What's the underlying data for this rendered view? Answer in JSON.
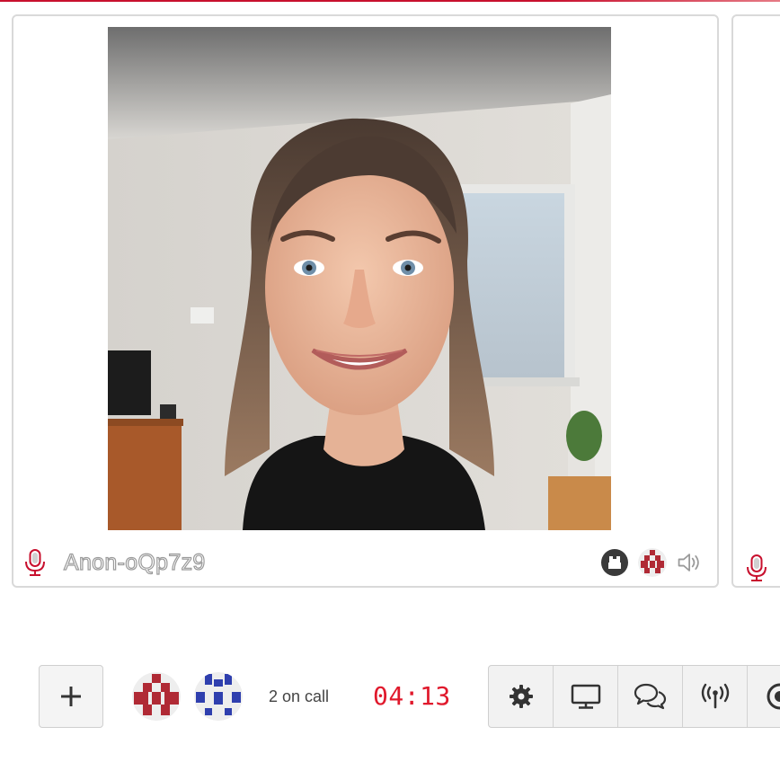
{
  "participant": {
    "name": "Anon-oQp7z9"
  },
  "call": {
    "participants_count_label": "2 on call",
    "timer": "04:13"
  },
  "avatars": [
    {
      "name": "red-avatar",
      "color": "#b02a35"
    },
    {
      "name": "blue-avatar",
      "color": "#2f3fae"
    }
  ],
  "toolbar": {
    "items": [
      {
        "icon": "gear-icon"
      },
      {
        "icon": "monitor-icon"
      },
      {
        "icon": "chat-icon"
      },
      {
        "icon": "broadcast-icon"
      },
      {
        "icon": "record-icon"
      }
    ]
  },
  "colors": {
    "accent": "#c8102e",
    "timer": "#e0192c"
  }
}
